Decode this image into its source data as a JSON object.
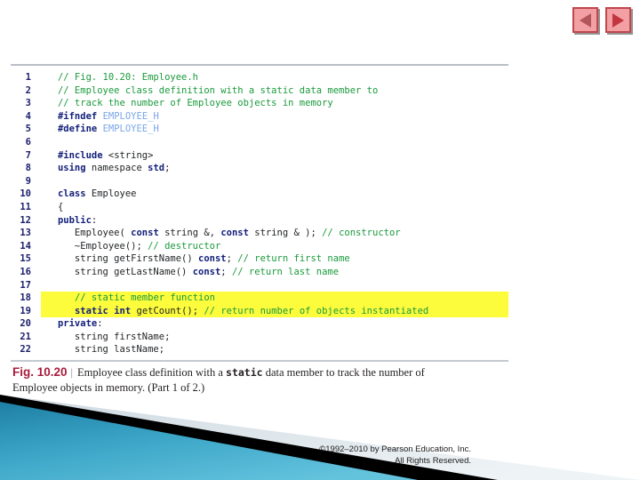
{
  "slide": {
    "nav": {
      "prev_label": "Previous slide",
      "prev_icon": "triangle-left-icon",
      "next_label": "Next slide",
      "next_icon": "triangle-right-icon"
    },
    "figure": {
      "lines": [
        {
          "n": "1",
          "highlight": false,
          "tokens": [
            {
              "t": "   ",
              "c": "pl"
            },
            {
              "t": "// Fig. 10.20: Employee.h",
              "c": "cm"
            }
          ]
        },
        {
          "n": "2",
          "highlight": false,
          "tokens": [
            {
              "t": "   ",
              "c": "pl"
            },
            {
              "t": "// Employee class definition with a static data member to",
              "c": "cm"
            }
          ]
        },
        {
          "n": "3",
          "highlight": false,
          "tokens": [
            {
              "t": "   ",
              "c": "pl"
            },
            {
              "t": "// track the number of Employee objects in memory",
              "c": "cm"
            }
          ]
        },
        {
          "n": "4",
          "highlight": false,
          "tokens": [
            {
              "t": "   ",
              "c": "pl"
            },
            {
              "t": "#ifndef",
              "c": "pp"
            },
            {
              "t": " ",
              "c": "pl"
            },
            {
              "t": "EMPLOYEE_H",
              "c": "mac"
            }
          ]
        },
        {
          "n": "5",
          "highlight": false,
          "tokens": [
            {
              "t": "   ",
              "c": "pl"
            },
            {
              "t": "#define",
              "c": "pp"
            },
            {
              "t": " ",
              "c": "pl"
            },
            {
              "t": "EMPLOYEE_H",
              "c": "mac"
            }
          ]
        },
        {
          "n": "6",
          "highlight": false,
          "tokens": [
            {
              "t": "",
              "c": "pl"
            }
          ]
        },
        {
          "n": "7",
          "highlight": false,
          "tokens": [
            {
              "t": "   ",
              "c": "pl"
            },
            {
              "t": "#include",
              "c": "pp"
            },
            {
              "t": " ",
              "c": "pl"
            },
            {
              "t": "<string>",
              "c": "pl"
            }
          ]
        },
        {
          "n": "8",
          "highlight": false,
          "tokens": [
            {
              "t": "   ",
              "c": "pl"
            },
            {
              "t": "using",
              "c": "kw"
            },
            {
              "t": " namespace ",
              "c": "pl"
            },
            {
              "t": "std",
              "c": "kw"
            },
            {
              "t": ";",
              "c": "pl"
            }
          ]
        },
        {
          "n": "9",
          "highlight": false,
          "tokens": [
            {
              "t": "",
              "c": "pl"
            }
          ]
        },
        {
          "n": "10",
          "highlight": false,
          "tokens": [
            {
              "t": "   ",
              "c": "pl"
            },
            {
              "t": "class",
              "c": "kw"
            },
            {
              "t": " Employee",
              "c": "pl"
            }
          ]
        },
        {
          "n": "11",
          "highlight": false,
          "tokens": [
            {
              "t": "   {",
              "c": "pl"
            }
          ]
        },
        {
          "n": "12",
          "highlight": false,
          "tokens": [
            {
              "t": "   ",
              "c": "pl"
            },
            {
              "t": "public",
              "c": "kw"
            },
            {
              "t": ":",
              "c": "pl"
            }
          ]
        },
        {
          "n": "13",
          "highlight": false,
          "tokens": [
            {
              "t": "      Employee( ",
              "c": "pl"
            },
            {
              "t": "const",
              "c": "kw"
            },
            {
              "t": " string &, ",
              "c": "pl"
            },
            {
              "t": "const",
              "c": "kw"
            },
            {
              "t": " string & ); ",
              "c": "pl"
            },
            {
              "t": "// constructor",
              "c": "cm"
            }
          ]
        },
        {
          "n": "14",
          "highlight": false,
          "tokens": [
            {
              "t": "      ~Employee(); ",
              "c": "pl"
            },
            {
              "t": "// destructor",
              "c": "cm"
            }
          ]
        },
        {
          "n": "15",
          "highlight": false,
          "tokens": [
            {
              "t": "      string getFirstName() ",
              "c": "pl"
            },
            {
              "t": "const",
              "c": "kw"
            },
            {
              "t": "; ",
              "c": "pl"
            },
            {
              "t": "// return first name",
              "c": "cm"
            }
          ]
        },
        {
          "n": "16",
          "highlight": false,
          "tokens": [
            {
              "t": "      string getLastName() ",
              "c": "pl"
            },
            {
              "t": "const",
              "c": "kw"
            },
            {
              "t": "; ",
              "c": "pl"
            },
            {
              "t": "// return last name",
              "c": "cm"
            }
          ]
        },
        {
          "n": "17",
          "highlight": false,
          "tokens": [
            {
              "t": "",
              "c": "pl"
            }
          ]
        },
        {
          "n": "18",
          "highlight": true,
          "tokens": [
            {
              "t": "      ",
              "c": "pl"
            },
            {
              "t": "// static member function",
              "c": "cm"
            }
          ]
        },
        {
          "n": "19",
          "highlight": true,
          "tokens": [
            {
              "t": "      ",
              "c": "pl"
            },
            {
              "t": "static",
              "c": "kw"
            },
            {
              "t": " ",
              "c": "pl"
            },
            {
              "t": "int",
              "c": "kw"
            },
            {
              "t": " getCount(); ",
              "c": "pl"
            },
            {
              "t": "// return number of objects instantiated",
              "c": "cm"
            }
          ]
        },
        {
          "n": "20",
          "highlight": false,
          "tokens": [
            {
              "t": "   ",
              "c": "pl"
            },
            {
              "t": "private",
              "c": "kw"
            },
            {
              "t": ":",
              "c": "pl"
            }
          ]
        },
        {
          "n": "21",
          "highlight": false,
          "tokens": [
            {
              "t": "      string firstName;",
              "c": "pl"
            }
          ]
        },
        {
          "n": "22",
          "highlight": false,
          "tokens": [
            {
              "t": "      string lastName;",
              "c": "pl"
            }
          ]
        }
      ]
    },
    "caption": {
      "fig_label": "Fig. 10.20",
      "separator": "|",
      "part_a": "Employee class definition with a ",
      "mono": "static",
      "part_b": " data member to track the number of Employee objects in memory. (Part 1 of 2.)"
    },
    "footer": {
      "line1": "©1992–2010 by Pearson Education, Inc.",
      "line2": "All Rights Reserved."
    },
    "colors": {
      "comment_green": "#1a9a3c",
      "keyword_navy": "#14207a",
      "macro_blue": "#7aa6e8",
      "highlight_yellow": "#fcfc3c",
      "fig_label_red": "#a81c3c",
      "deco_blue": "#2a95bb",
      "nav_button_pink": "#f2a0a3"
    }
  }
}
